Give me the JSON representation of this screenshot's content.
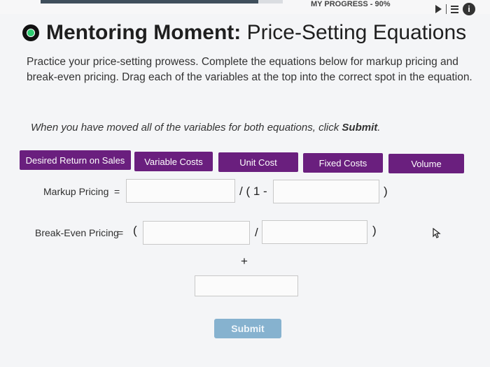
{
  "progress": {
    "label": "MY PROGRESS - 90%",
    "fraction": 0.9
  },
  "header": {
    "title_bold": "Mentoring Moment:",
    "title_rest": " Price-Setting Equations"
  },
  "intro_text": "Practice your price-setting prowess. Complete the equations below for markup pricing and break-even pricing. Drag each of the variables at the top into the correct spot in the equation.",
  "instruction": {
    "prefix": "When you have moved all of the variables for both equations, click ",
    "submit_word": "Submit",
    "suffix": "."
  },
  "variables": [
    {
      "label": "Desired Return on Sales"
    },
    {
      "label": "Variable Costs"
    },
    {
      "label": "Unit Cost"
    },
    {
      "label": "Fixed Costs"
    },
    {
      "label": "Volume"
    }
  ],
  "markup": {
    "label": "Markup Pricing",
    "equals": "=",
    "divide_open": "/ ( 1 -",
    "close_paren": ")"
  },
  "breakeven": {
    "label": "Break-Even Pricing",
    "equals": "=",
    "open_paren": "(",
    "divide": "/",
    "close_paren": ")",
    "plus": "+"
  },
  "submit_label": "Submit",
  "colors": {
    "chip": "#6a1f7e",
    "submit": "#86b2cf"
  },
  "icons": [
    "play-icon",
    "menu-icon",
    "info-icon",
    "mentoring-icon",
    "cursor-icon"
  ]
}
